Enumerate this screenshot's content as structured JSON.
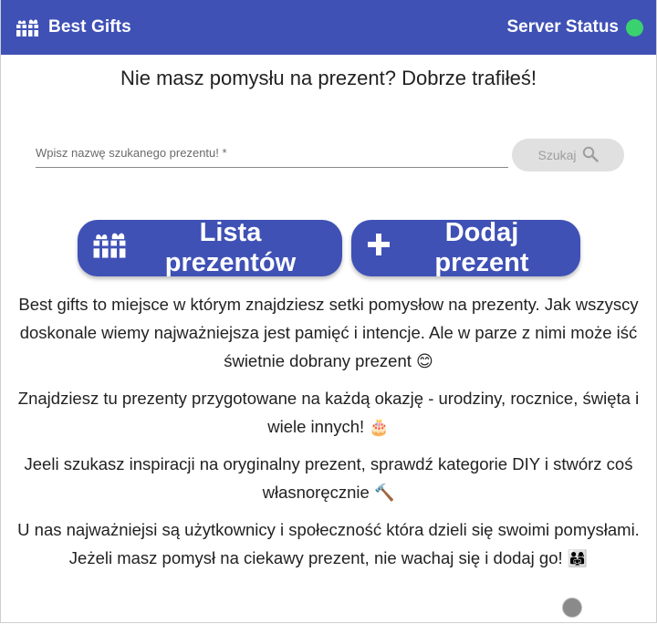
{
  "header": {
    "brand_title": "Best Gifts",
    "brand_icon": "gift-icon",
    "server_status_label": "Server Status",
    "server_status_color": "#3ad26f"
  },
  "headline": "Nie masz pomysłu na prezent? Dobrze trafiłeś!",
  "search": {
    "placeholder": "Wpisz nazwę szukanego prezentu! *",
    "value": "",
    "button_label": "Szukaj"
  },
  "actions": {
    "list_label": "Lista prezentów",
    "add_label": "Dodaj prezent"
  },
  "description": {
    "p1": "Best gifts to miejsce w którym znajdziesz setki pomysłow na prezenty. Jak wszyscy doskonale wiemy najważniejsza jest pamięć i intencje. Ale w parze z nimi może iść świetnie dobrany prezent",
    "p1_emoji": "😊",
    "p2": "Znajdziesz tu prezenty przygotowane na każdą okazję - urodziny, rocznice, święta i wiele innych!",
    "p2_emoji": "🎂",
    "p3": "Jeeli szukasz inspiracji na oryginalny prezent, sprawdź kategorie DIY i stwórz coś własnoręcznie",
    "p3_emoji": "🔨",
    "p4": "U nas najważniejsi są użytkownicy i społeczność która dzieli się swoimi pomysłami. Jeżeli masz pomysł na ciekawy prezent, nie wachaj się i dodaj go!",
    "p4_emoji": "👨‍👩‍👧"
  },
  "colors": {
    "primary": "#3f51b5",
    "search_button_bg": "#e0e0e0"
  }
}
